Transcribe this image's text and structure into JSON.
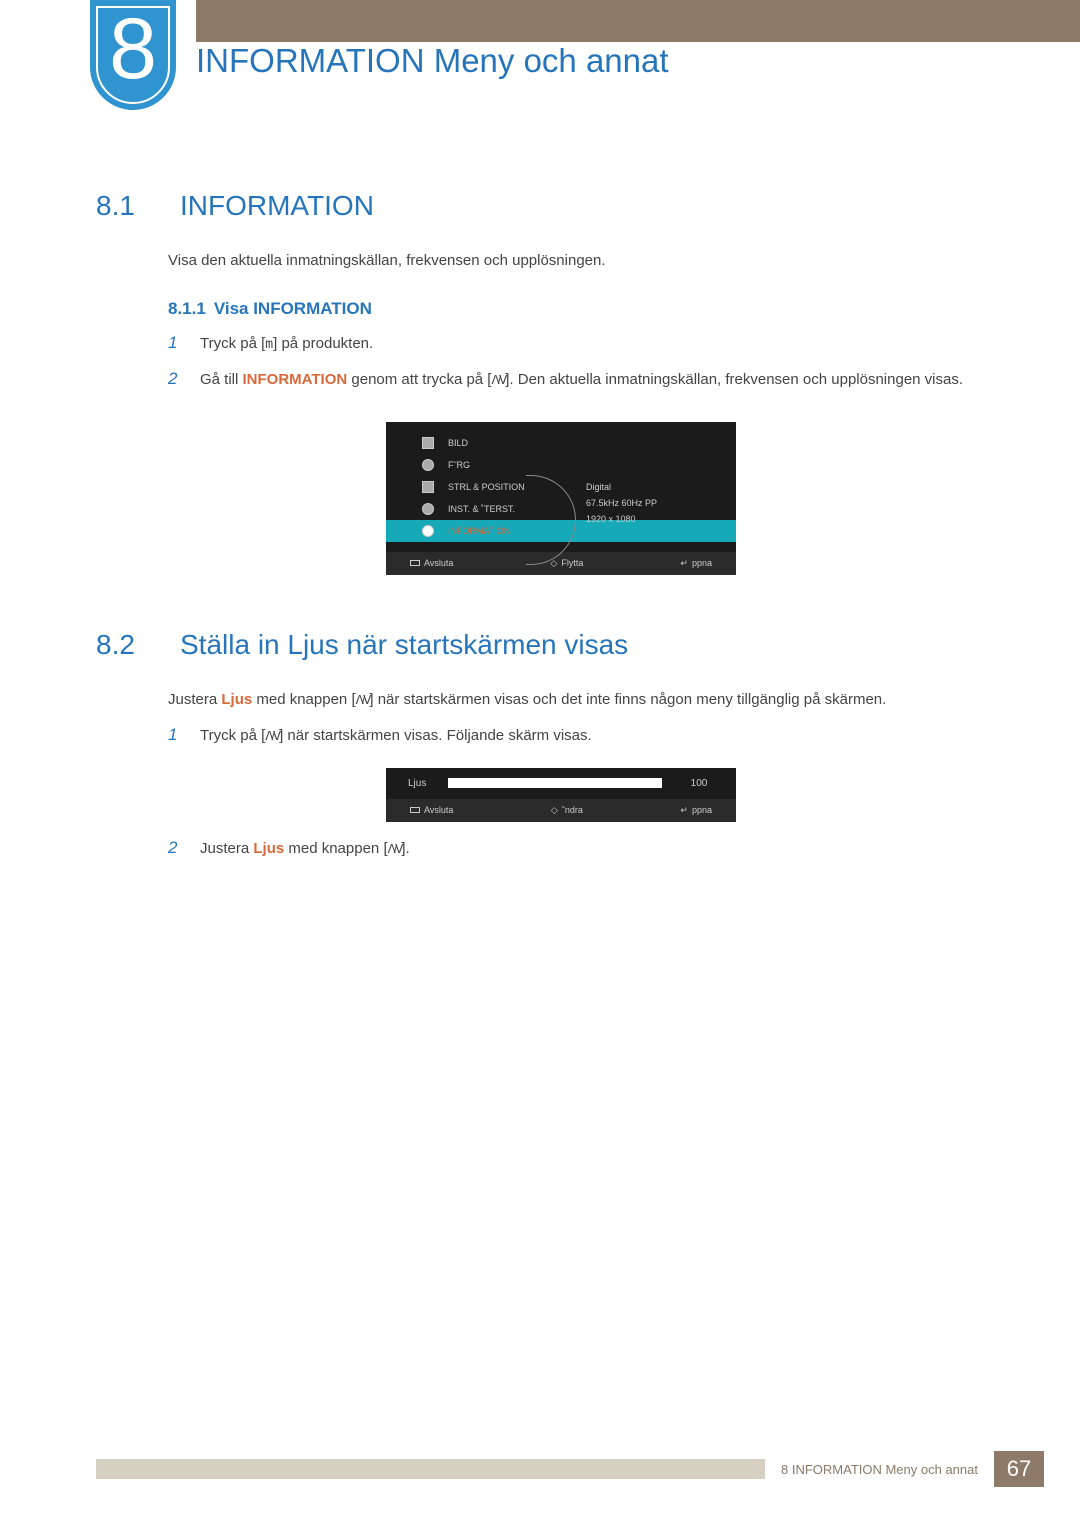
{
  "chapter": {
    "number": "8",
    "title": "INFORMATION Meny och annat"
  },
  "section81": {
    "num": "8.1",
    "title": "INFORMATION",
    "intro": "Visa den aktuella inmatningskällan, frekvensen och upplösningen.",
    "sub_num": "8.1.1",
    "sub_title": "Visa INFORMATION",
    "step1_num": "1",
    "step1_a": "Tryck på [",
    "step1_key": "m",
    "step1_b": "] på produkten.",
    "step2_num": "2",
    "step2_a": "Gå till ",
    "step2_kw": "INFORMATION",
    "step2_b": " genom att trycka på [",
    "step2_c": "]. Den aktuella inmatningskällan, frekvensen och upplösningen visas."
  },
  "osd1": {
    "items": {
      "0": "BILD",
      "1": "F˜RG",
      "2": "STRL & POSITION",
      "3": "INST. & ˚TERST.",
      "4": "INFORMATION"
    },
    "info": {
      "0": "Digital",
      "1": "67.5kHz 60Hz PP",
      "2": "1920 x 1080"
    },
    "footer": {
      "0": "Avsluta",
      "1": "Flytta",
      "2": "ppna"
    }
  },
  "section82": {
    "num": "8.2",
    "title": "Ställa in Ljus när startskärmen visas",
    "intro_a": "Justera ",
    "intro_kw": "Ljus",
    "intro_b": " med knappen [",
    "intro_c": "] när startskärmen visas och det inte finns någon meny tillgänglig på skärmen.",
    "step1_num": "1",
    "step1_a": "Tryck på [",
    "step1_b": "] när startskärmen visas. Följande skärm visas.",
    "step2_num": "2",
    "step2_a": "Justera ",
    "step2_kw": "Ljus",
    "step2_b": " med knappen [",
    "step2_c": "]."
  },
  "osd2": {
    "label": "Ljus",
    "value": "100",
    "footer": {
      "0": "Avsluta",
      "1": "˜ndra",
      "2": "ppna"
    }
  },
  "footer": {
    "text": "8 INFORMATION Meny och annat",
    "page": "67"
  }
}
